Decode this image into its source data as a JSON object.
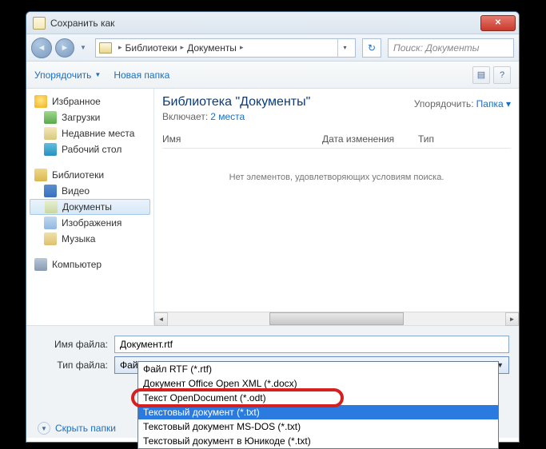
{
  "title": "Сохранить как",
  "breadcrumb": {
    "root": "Библиотеки",
    "current": "Документы"
  },
  "search_placeholder": "Поиск: Документы",
  "toolbar": {
    "organize": "Упорядочить",
    "new_folder": "Новая папка"
  },
  "sidebar": {
    "favorites": {
      "title": "Избранное",
      "items": [
        "Загрузки",
        "Недавние места",
        "Рабочий стол"
      ]
    },
    "libraries": {
      "title": "Библиотеки",
      "items": [
        "Видео",
        "Документы",
        "Изображения",
        "Музыка"
      ]
    },
    "computer": "Компьютер"
  },
  "content": {
    "heading": "Библиотека \"Документы\"",
    "subheading_prefix": "Включает:",
    "subheading_link": "2 места",
    "arrange_label": "Упорядочить:",
    "arrange_value": "Папка",
    "cols": {
      "name": "Имя",
      "date": "Дата изменения",
      "type": "Тип"
    },
    "empty": "Нет элементов, удовлетворяющих условиям поиска."
  },
  "fields": {
    "filename_label": "Имя файла:",
    "filename_value": "Документ.rtf",
    "filetype_label": "Тип файла:",
    "filetype_value": "Файл RTF (*.rtf)"
  },
  "dropdown": [
    "Файл RTF (*.rtf)",
    "Документ Office Open XML (*.docx)",
    "Текст OpenDocument (*.odt)",
    "Текстовый документ (*.txt)",
    "Текстовый документ MS-DOS (*.txt)",
    "Текстовый документ в Юникоде (*.txt)"
  ],
  "dropdown_selected_index": 3,
  "footer": {
    "hide_folders": "Скрыть папки"
  }
}
